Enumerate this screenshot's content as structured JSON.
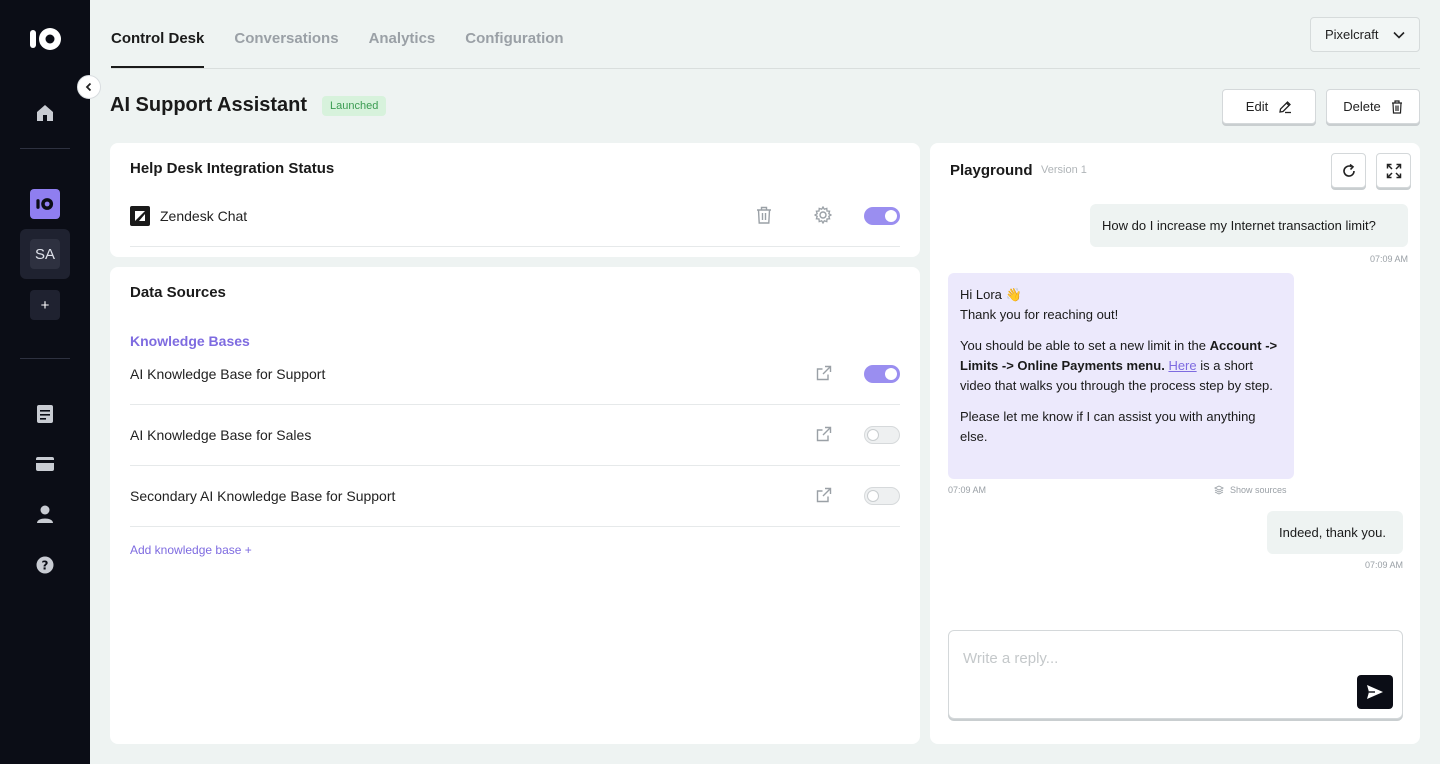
{
  "nav": {
    "tabs": [
      {
        "label": "Control Desk",
        "active": true
      },
      {
        "label": "Conversations",
        "active": false
      },
      {
        "label": "Analytics",
        "active": false
      },
      {
        "label": "Configuration",
        "active": false
      }
    ],
    "workspace": "Pixelcraft"
  },
  "sidebar": {
    "workspace_initials": "SA",
    "add_label": "+"
  },
  "header": {
    "title": "AI Support Assistant",
    "status": "Launched",
    "edit_label": "Edit",
    "delete_label": "Delete"
  },
  "helpdesk": {
    "title": "Help Desk Integration Status",
    "integration": {
      "name": "Zendesk Chat",
      "enabled": true
    }
  },
  "data_sources": {
    "title": "Data Sources",
    "kb_heading": "Knowledge Bases",
    "items": [
      {
        "name": "AI Knowledge Base for Support",
        "enabled": true
      },
      {
        "name": "AI Knowledge Base for Sales",
        "enabled": false
      },
      {
        "name": "Secondary AI Knowledge Base for Support",
        "enabled": false
      }
    ],
    "add_label": "Add knowledge base  +"
  },
  "playground": {
    "title": "Playground",
    "version": "Version 1",
    "messages": {
      "user1": {
        "text": "How do I increase my Internet transaction limit?",
        "time": "07:09 AM"
      },
      "bot": {
        "greeting": "Hi Lora 👋",
        "line2": "Thank you for reaching out!",
        "p1_before": "You should be able to set a new limit in the ",
        "p1_bold": "Account -> Limits -> Online Payments menu.",
        "p1_link": "Here",
        "p1_after": " is a short video that walks you through the process step by step.",
        "p2": "Please let me know if I can assist you with anything else.",
        "time": "07:09 AM",
        "show_sources": "Show sources"
      },
      "user2": {
        "text": "Indeed, thank you.",
        "time": "07:09 AM"
      }
    },
    "reply_placeholder": "Write a reply..."
  },
  "colors": {
    "accent": "#8f7ef0",
    "sidebar_bg": "#0b0d16",
    "badge_bg": "#d7f2dc",
    "badge_text": "#3b9c52"
  }
}
